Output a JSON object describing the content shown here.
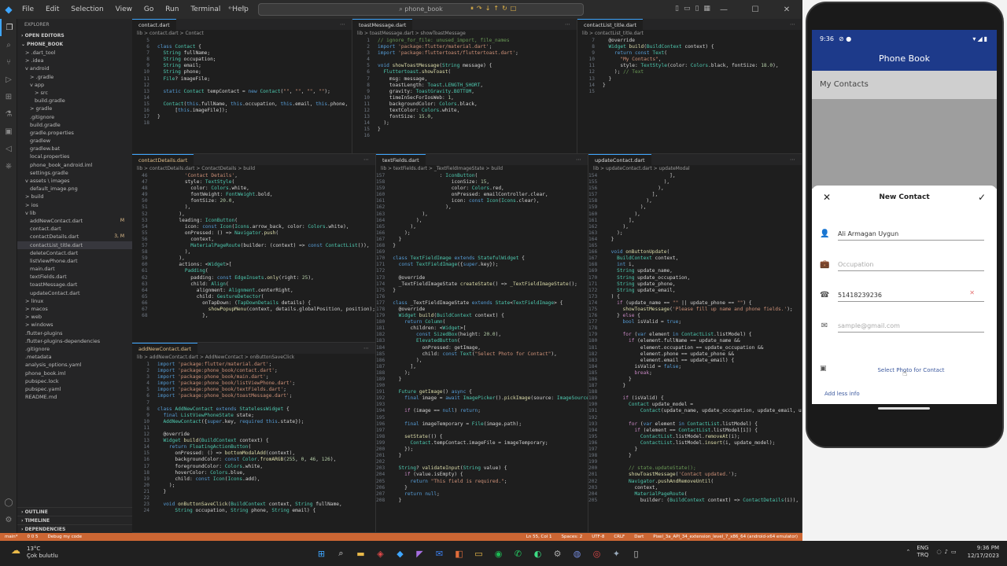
{
  "window": {
    "menus": [
      "File",
      "Edit",
      "Selection",
      "View",
      "Go",
      "Run",
      "Terminal",
      "Help"
    ],
    "search": "phone_book"
  },
  "explorer": {
    "header": "EXPLORER",
    "open_editors": "OPEN EDITORS",
    "project": "PHONE_BOOK",
    "rows": [
      {
        "label": "> .dart_tool",
        "indent": 1
      },
      {
        "label": "> .idea",
        "indent": 1
      },
      {
        "label": "v android",
        "indent": 1
      },
      {
        "label": "> .gradle",
        "indent": 2
      },
      {
        "label": "v app",
        "indent": 2
      },
      {
        "label": "> src",
        "indent": 3
      },
      {
        "label": "build.gradle",
        "indent": 3
      },
      {
        "label": "> gradle",
        "indent": 2
      },
      {
        "label": ".gitignore",
        "indent": 2
      },
      {
        "label": "build.gradle",
        "indent": 2
      },
      {
        "label": "gradle.properties",
        "indent": 2
      },
      {
        "label": "gradlew",
        "indent": 2
      },
      {
        "label": "gradlew.bat",
        "indent": 2
      },
      {
        "label": "local.properties",
        "indent": 2
      },
      {
        "label": "phone_book_android.iml",
        "indent": 2
      },
      {
        "label": "settings.gradle",
        "indent": 2
      },
      {
        "label": "v assets \\ images",
        "indent": 1
      },
      {
        "label": "default_image.png",
        "indent": 2
      },
      {
        "label": "> build",
        "indent": 1
      },
      {
        "label": "> ios",
        "indent": 1
      },
      {
        "label": "v lib",
        "indent": 1
      },
      {
        "label": "addNewContact.dart",
        "indent": 2,
        "badge": "M"
      },
      {
        "label": "contact.dart",
        "indent": 2
      },
      {
        "label": "contactDetails.dart",
        "indent": 2,
        "badge": "3, M"
      },
      {
        "label": "contactList_title.dart",
        "indent": 2,
        "sel": true
      },
      {
        "label": "deleteContact.dart",
        "indent": 2
      },
      {
        "label": "listViewPhone.dart",
        "indent": 2
      },
      {
        "label": "main.dart",
        "indent": 2
      },
      {
        "label": "textFields.dart",
        "indent": 2
      },
      {
        "label": "toastMessage.dart",
        "indent": 2
      },
      {
        "label": "updateContact.dart",
        "indent": 2
      },
      {
        "label": "> linux",
        "indent": 1
      },
      {
        "label": "> macos",
        "indent": 1
      },
      {
        "label": "> web",
        "indent": 1
      },
      {
        "label": "> windows",
        "indent": 1
      },
      {
        "label": ".flutter-plugins",
        "indent": 1
      },
      {
        "label": ".flutter-plugins-dependencies",
        "indent": 1
      },
      {
        "label": ".gitignore",
        "indent": 1
      },
      {
        "label": ".metadata",
        "indent": 1
      },
      {
        "label": "analysis_options.yaml",
        "indent": 1
      },
      {
        "label": "phone_book.iml",
        "indent": 1
      },
      {
        "label": "pubspec.lock",
        "indent": 1
      },
      {
        "label": "pubspec.yaml",
        "indent": 1
      },
      {
        "label": "README.md",
        "indent": 1
      }
    ],
    "outline": "OUTLINE",
    "timeline": "TIMELINE",
    "dependencies": "DEPENDENCIES"
  },
  "panes": [
    {
      "tab": "contact.dart",
      "modified": false,
      "breadcrumb": "lib > contact.dart > Contact",
      "start": 5,
      "lines": [
        "",
        "class Contact {",
        "  String fullName;",
        "  String occupation;",
        "  String email;",
        "  String phone;",
        "  File? imageFile;",
        "",
        "  static Contact tempContact = new Contact(\"\", \"\", \"\", \"\");",
        "",
        "  Contact(this.fullName, this.occupation, this.email, this.phone,",
        "      [this.imageFile]);",
        "}",
        ""
      ]
    },
    {
      "tab": "toastMessage.dart",
      "modified": false,
      "breadcrumb": "lib > toastMessage.dart > showToastMessage",
      "start": 1,
      "lines": [
        "// ignore_for_file: unused_import, file_names",
        "import 'package:flutter/material.dart';",
        "import 'package:fluttertoast/fluttertoast.dart';",
        "",
        "void showToastMessage(String message) {",
        "  Fluttertoast.showToast(",
        "    msg: message,",
        "    toastLength: Toast.LENGTH_SHORT,",
        "    gravity: ToastGravity.BOTTOM,",
        "    timeInSecForIosWeb: 1,",
        "    backgroundColor: Colors.black,",
        "    textColor: Colors.white,",
        "    fontSize: 15.0,",
        "  );",
        "}",
        ""
      ]
    },
    {
      "tab": "contactList_title.dart",
      "modified": false,
      "breadcrumb": "lib > contactList_title.dart",
      "start": 7,
      "lines": [
        "  @override",
        "  Widget build(BuildContext context) {",
        "    return const Text(",
        "      \"My Contacts\",",
        "      style: TextStyle(color: Colors.black, fontSize: 18.0),",
        "    ); // Text",
        "  }",
        "}",
        ""
      ]
    },
    {
      "tab": "contactDetails.dart",
      "modified": true,
      "breadcrumb": "lib > contactDetails.dart > ContactDetails > build",
      "start": 46,
      "lines": [
        "          'Contact Details',",
        "          style: TextStyle(",
        "            color: Colors.white,",
        "            fontWeight: FontWeight.bold,",
        "            fontSize: 20.0,",
        "          ),",
        "        ),",
        "        leading: IconButton(",
        "          icon: const Icon(Icons.arrow_back, color: Colors.white),",
        "          onPressed: () => Navigator.push(",
        "            context,",
        "            MaterialPageRoute(builder: (context) => const ContactList()),",
        "          ),",
        "        ),",
        "        actions: <Widget>[",
        "          Padding(",
        "            padding: const EdgeInsets.only(right: 25),",
        "            child: Align(",
        "              alignment: Alignment.centerRight,",
        "              child: GestureDetector(",
        "                onTapDown: (TapDownDetails details) {",
        "                  showPopupMenu(context, details.globalPosition, position);",
        "                },"
      ]
    },
    {
      "tab": "textFields.dart",
      "modified": false,
      "breadcrumb": "lib > textFields.dart > _TextFieldImageState > build",
      "start": 157,
      "lines": [
        "                : IconButton(",
        "                    iconSize: 15,",
        "                    color: Colors.red,",
        "                    onPressed: emailController.clear,",
        "                    icon: const Icon(Icons.clear),",
        "                  ),",
        "          ),",
        "        ),",
        "      ),",
        "    );",
        "  }",
        "}",
        "",
        "class TextFieldImage extends StatefulWidget {",
        "  const TextFieldImage({super.key});",
        "",
        "  @override",
        "  _TextFieldImageState createState() => _TextFieldImageState();",
        "}",
        "",
        "class _TextFieldImageState extends State<TextFieldImage> {",
        "  @override",
        "  Widget build(BuildContext context) {",
        "    return Column(",
        "      children: <Widget>[",
        "        const SizedBox(height: 20.0),",
        "        ElevatedButton(",
        "          onPressed: getImage,",
        "          child: const Text(\"Select Photo for Contact\"),",
        "        ),",
        "      ],",
        "    );",
        "  }",
        "",
        "  Future getImage() async {",
        "    final image = await ImagePicker().pickImage(source: ImageSource",
        "",
        "    if (image == null) return;",
        "",
        "    final imageTemporary = File(image.path);",
        "",
        "    setState(() {",
        "      Contact.tempContact.imageFile = imageTemporary;",
        "    });",
        "  }",
        "",
        "  String? validateInput(String value) {",
        "    if (value.isEmpty) {",
        "      return \"This field is required.\";",
        "    }",
        "    return null;",
        "  }"
      ]
    },
    {
      "tab": "updateContact.dart",
      "modified": false,
      "breadcrumb": "lib > updateContact.dart > updateModal",
      "start": 154,
      "lines": [
        "                      ],",
        "                    ),",
        "                  ),",
        "                ],",
        "              ),",
        "            ),",
        "          ),",
        "        ],",
        "      ),",
        "    );",
        "  }",
        "  ",
        "  void onButtonUpdate(",
        "    BuildContext context,",
        "    int i,",
        "    String update_name,",
        "    String update_occupation,",
        "    String update_phone,",
        "    String update_email,",
        "  ) {",
        "    if (update_name == \"\" || update_phone == \"\") {",
        "      showToastMessage('Please fill up name and phone fields.');",
        "    } else {",
        "      bool isValid = true;",
        "",
        "      for (var element in ContactList.listModel) {",
        "        if (element.fullName == update_name &&",
        "            element.occupation == update_occupation &&",
        "            element.phone == update_phone &&",
        "            element.email == update_email) {",
        "          isValid = false;",
        "          break;",
        "        }",
        "      }",
        "",
        "      if (isValid) {",
        "        Contact update_model =",
        "            Contact(update_name, update_occupation, update_email, upd",
        "",
        "        for (var element in ContactList.listModel) {",
        "          if (element == ContactList.listModel[i]) {",
        "            ContactList.listModel.removeAt(i);",
        "            ContactList.listModel.insert(i, update_model);",
        "          }",
        "        }",
        "",
        "        // state.updateState();",
        "        showToastMessage('Contact updated.');",
        "        Navigator.pushAndRemoveUntil(",
        "          context,",
        "          MaterialPageRoute(",
        "            builder: (BuildContext context) => ContactDetails(i)),"
      ]
    },
    {
      "tab": "addNewContact.dart",
      "modified": true,
      "breadcrumb": "lib > addNewContact.dart > AddNewContact > onButtonSaveClick",
      "start": 1,
      "lines": [
        "import 'package:flutter/material.dart';",
        "import 'package:phone_book/contact.dart';",
        "import 'package:phone_book/main.dart';",
        "import 'package:phone_book/listViewPhone.dart';",
        "import 'package:phone_book/textFields.dart';",
        "import 'package:phone_book/toastMessage.dart';",
        "",
        "class AddNewContact extends StatelessWidget {",
        "  final ListViewPhoneState state;",
        "  AddNewContact({super.key, required this.state});",
        "",
        "  @override",
        "  Widget build(BuildContext context) {",
        "    return FloatingActionButton(",
        "      onPressed: () => bottomModalAdd(context),",
        "      backgroundColor: const Color.fromARGB(255, 0, 46, 126),",
        "      foregroundColor: Colors.white,",
        "      hoverColor: Colors.blue,",
        "      child: const Icon(Icons.add),",
        "    );",
        "  }",
        "",
        "  void onButtonSaveClick(BuildContext context, String fullName,",
        "      String occupation, String phone, String email) {"
      ]
    }
  ],
  "statusbar": {
    "left": [
      "main*",
      "0  0  5",
      "Debug my code"
    ],
    "right": [
      "Ln 55, Col 1",
      "Spaces: 2",
      "UTF-8",
      "CRLF",
      "Dart",
      "Pixel_3a_API_34_extension_level_7_x86_64 (android-x64 emulator)"
    ]
  },
  "phone": {
    "time": "9:36",
    "app_title": "Phone Book",
    "list_title": "My Contacts",
    "sheet_title": "New Contact",
    "fields": [
      {
        "icon": "person-icon",
        "glyph": "👤",
        "value": "Ali Armagan Uygun",
        "placeholder": false
      },
      {
        "icon": "briefcase-icon",
        "glyph": "💼",
        "value": "Occupation",
        "placeholder": true
      },
      {
        "icon": "phone-icon",
        "glyph": "☎",
        "value": "51418239236",
        "placeholder": false,
        "clear": true
      },
      {
        "icon": "mail-icon",
        "glyph": "✉",
        "value": "sample@gmail.com",
        "placeholder": true
      }
    ],
    "select_photo": "Select Photo for Contact",
    "add_less": "Add less info"
  },
  "taskbar": {
    "temp": "13°C",
    "weather": "Çok bulutlu",
    "lang": "ENG",
    "lang2": "TRQ",
    "time": "9:36 PM",
    "date": "12/17/2023"
  },
  "colors": {
    "accent": "#3ea6ff",
    "status": "#cc6633",
    "app_bar": "#1d3a8a"
  }
}
